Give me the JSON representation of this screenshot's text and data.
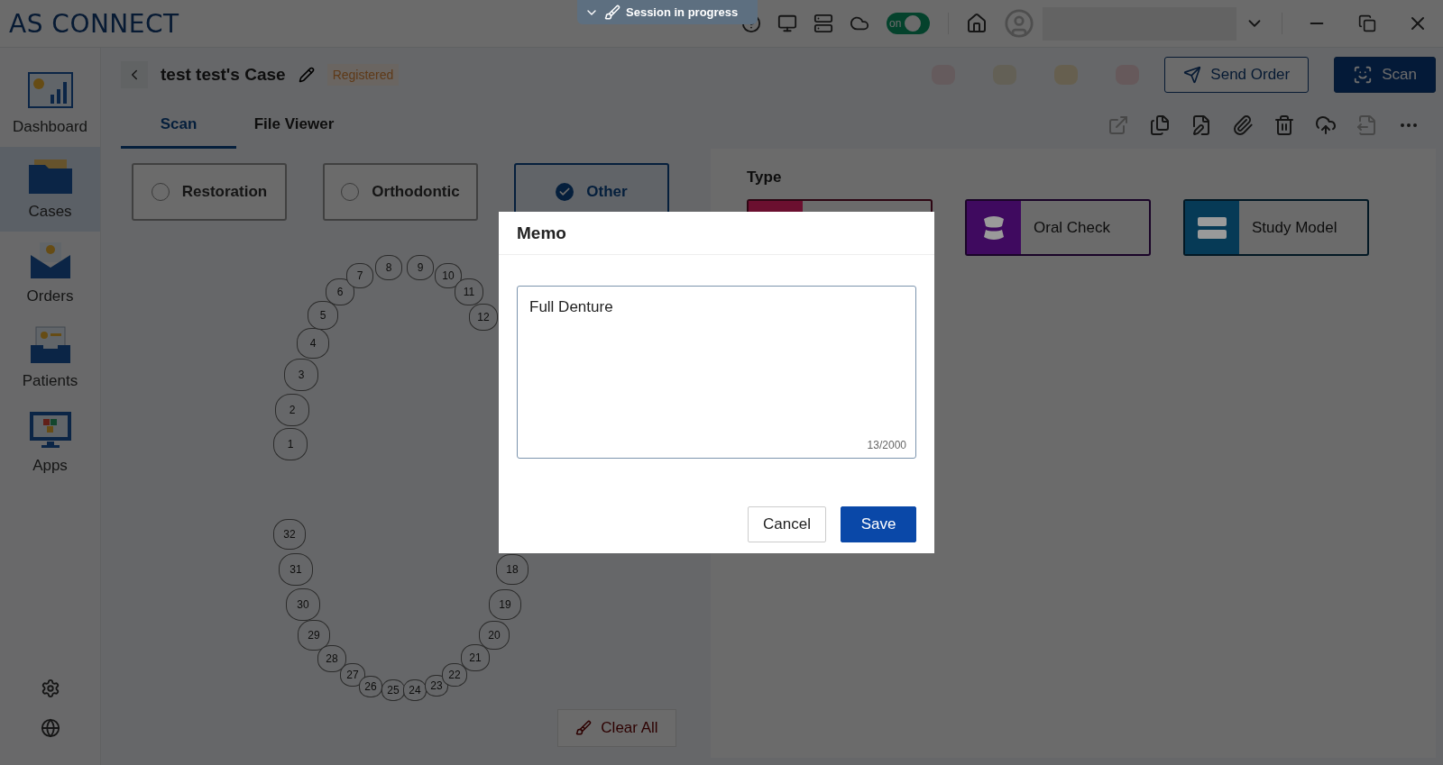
{
  "app": {
    "logo": "AS CONNECT"
  },
  "session": {
    "label": "Session in progress"
  },
  "top_bar": {
    "sync_toggle": {
      "label": "on",
      "on": true
    }
  },
  "sidebar": {
    "items": [
      {
        "label": "Dashboard",
        "selected": false
      },
      {
        "label": "Cases",
        "selected": true
      },
      {
        "label": "Orders",
        "selected": false
      },
      {
        "label": "Patients",
        "selected": false
      },
      {
        "label": "Apps",
        "selected": false
      }
    ]
  },
  "case": {
    "title": "test test's Case",
    "status": "Registered"
  },
  "header_buttons": [
    {
      "label": "Send Order",
      "kind": "outline"
    },
    {
      "label": "Scan",
      "kind": "primary"
    }
  ],
  "tabs": [
    {
      "label": "Scan",
      "selected": true
    },
    {
      "label": "File Viewer",
      "selected": false
    }
  ],
  "categories": [
    {
      "label": "Restoration",
      "selected": false
    },
    {
      "label": "Orthodontic",
      "selected": false
    },
    {
      "label": "Other",
      "selected": true
    }
  ],
  "teeth": {
    "upper": [
      "1",
      "2",
      "3",
      "4",
      "5",
      "6",
      "7",
      "8",
      "9",
      "10",
      "11",
      "12"
    ],
    "lower": [
      "32",
      "31",
      "30",
      "29",
      "28",
      "27",
      "26",
      "25",
      "24",
      "23",
      "22",
      "21",
      "20",
      "19",
      "18"
    ]
  },
  "clear_button": {
    "label": "Clear All",
    "disabled": true
  },
  "type_panel": {
    "title": "Type",
    "cards": [
      {
        "color": "#6b0f2f"
      },
      {
        "label": "Oral Check",
        "color": "#3f0a5f"
      },
      {
        "label": "Study Model",
        "color": "#063a56"
      }
    ]
  },
  "memo_dialog": {
    "title": "Memo",
    "value": "Full Denture",
    "counter": "13/2000",
    "buttons": [
      {
        "label": "Cancel",
        "kind": "secondary"
      },
      {
        "label": "Save",
        "kind": "primary"
      }
    ]
  }
}
